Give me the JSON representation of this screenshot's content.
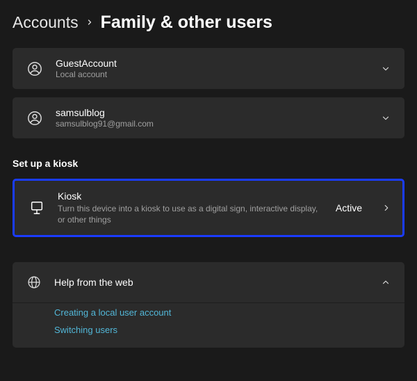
{
  "breadcrumb": {
    "parent": "Accounts",
    "current": "Family & other users"
  },
  "users": [
    {
      "name": "GuestAccount",
      "sub": "Local account"
    },
    {
      "name": "samsulblog",
      "sub": "samsulblog91@gmail.com"
    }
  ],
  "kiosk_section": {
    "title": "Set up a kiosk",
    "card": {
      "title": "Kiosk",
      "description": "Turn this device into a kiosk to use as a digital sign, interactive display, or other things",
      "status": "Active"
    }
  },
  "help": {
    "title": "Help from the web",
    "links": [
      "Creating a local user account",
      "Switching users"
    ]
  },
  "colors": {
    "highlight_border": "#1a3cff",
    "link": "#52b7d8"
  }
}
